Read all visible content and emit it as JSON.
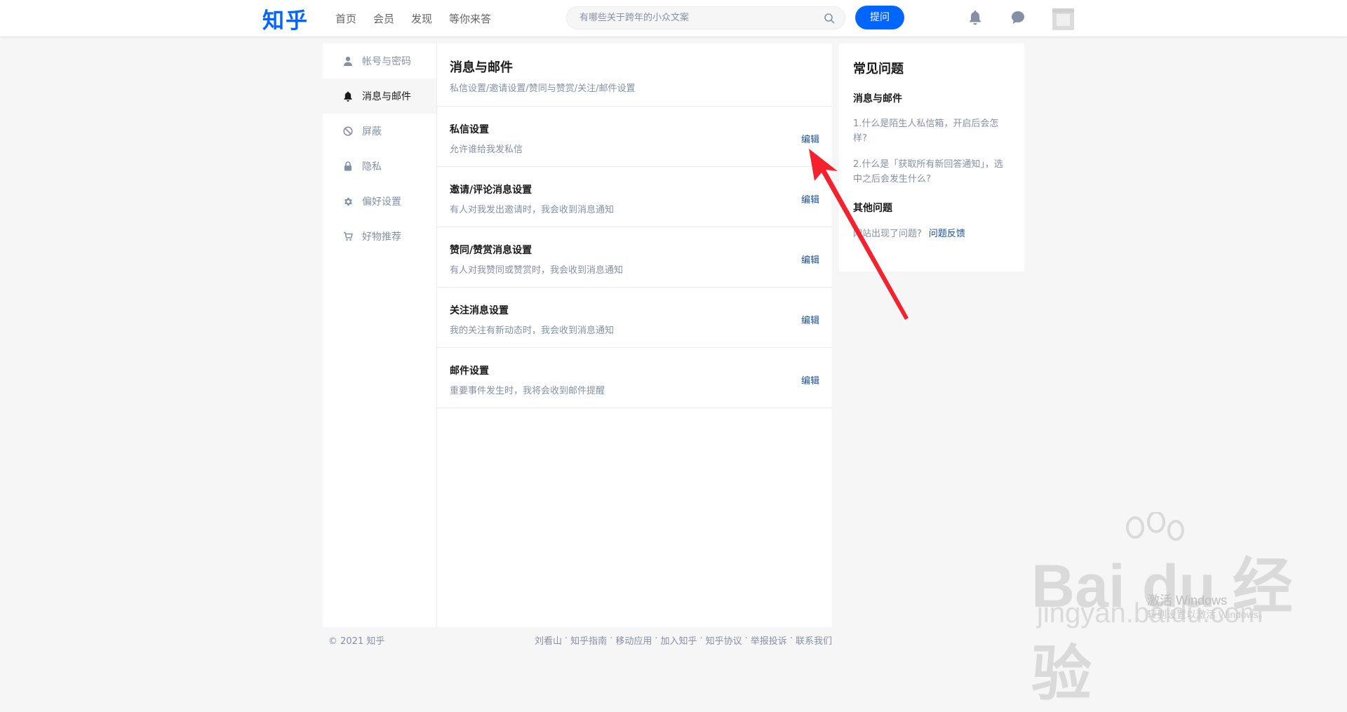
{
  "header": {
    "logo": "知乎",
    "nav": [
      "首页",
      "会员",
      "发现",
      "等你来答"
    ],
    "search_placeholder": "有哪些关于跨年的小众文案",
    "ask_label": "提问",
    "icons": [
      "search-icon",
      "bell-icon",
      "chat-icon"
    ]
  },
  "sidebar": {
    "items": [
      {
        "label": "帐号与密码",
        "icon": "user-icon"
      },
      {
        "label": "消息与邮件",
        "icon": "bell-icon",
        "active": true
      },
      {
        "label": "屏蔽",
        "icon": "block-icon"
      },
      {
        "label": "隐私",
        "icon": "lock-icon"
      },
      {
        "label": "偏好设置",
        "icon": "gear-icon"
      },
      {
        "label": "好物推荐",
        "icon": "cart-icon"
      }
    ]
  },
  "main": {
    "title": "消息与邮件",
    "subtitle": "私信设置/邀请设置/赞同与赞赏/关注/邮件设置",
    "rows": [
      {
        "title": "私信设置",
        "desc": "允许谁给我发私信",
        "edit": "编辑"
      },
      {
        "title": "邀请/评论消息设置",
        "desc": "有人对我发出邀请时，我会收到消息通知",
        "edit": "编辑"
      },
      {
        "title": "赞同/赞赏消息设置",
        "desc": "有人对我赞同或赞赏时，我会收到消息通知",
        "edit": "编辑"
      },
      {
        "title": "关注消息设置",
        "desc": "我的关注有新动态时，我会收到消息通知",
        "edit": "编辑"
      },
      {
        "title": "邮件设置",
        "desc": "重要事件发生时，我将会收到邮件提醒",
        "edit": "编辑"
      }
    ]
  },
  "faq": {
    "title": "常见问题",
    "section": "消息与邮件",
    "questions": [
      "1.什么是陌生人私信箱，开启后会怎样?",
      "2.什么是「获取所有新回答通知」，选中之后会发生什么?"
    ],
    "other_title": "其他问题",
    "other_text": "网站出现了问题?",
    "other_link": "问题反馈"
  },
  "footer": {
    "copyright": "© 2021 知乎",
    "links": [
      "刘看山",
      "知乎指南",
      "移动应用",
      "加入知乎",
      "知乎协议",
      "举报投诉",
      "联系我们"
    ],
    "separator": "·"
  },
  "watermark": {
    "brand": "Bai du 经验",
    "site": "jingyan.baidu.com",
    "activate": "激活 Windows",
    "activate_hint": "转到设置以激活 Windows。"
  },
  "colors": {
    "brand": "#0066ff",
    "link": "#175199",
    "muted": "#8590a6",
    "annotation_arrow": "#f5222d"
  }
}
